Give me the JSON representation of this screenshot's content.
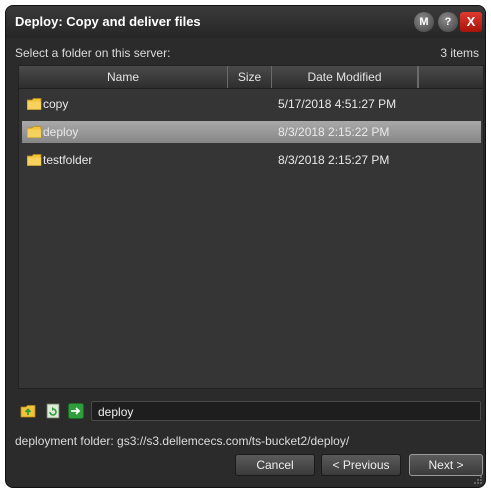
{
  "window": {
    "title": "Deploy: Copy and deliver files",
    "buttons": {
      "m_label": "M",
      "help_label": "?",
      "close_label": "X"
    }
  },
  "browser": {
    "prompt": "Select a folder on this server:",
    "item_count": "3 items",
    "columns": {
      "name": "Name",
      "size": "Size",
      "date": "Date Modified"
    },
    "rows": [
      {
        "name": "copy",
        "date": "5/17/2018 4:51:27 PM",
        "selected": false
      },
      {
        "name": "deploy",
        "date": "8/3/2018 2:15:22 PM",
        "selected": true
      },
      {
        "name": "testfolder",
        "date": "8/3/2018 2:15:27 PM",
        "selected": false
      }
    ]
  },
  "pathbar": {
    "icons": [
      "folder-up-icon",
      "refresh-icon",
      "enter-icon"
    ],
    "value": "deploy"
  },
  "deployment_folder": "deployment folder: gs3://s3.dellemcecs.com/ts-bucket2/deploy/",
  "actions": {
    "cancel": "Cancel",
    "previous": "< Previous",
    "next": "Next >"
  },
  "colors": {
    "folder": "#f2c33b",
    "selection": "#9a9a9a",
    "close": "#d12a1f",
    "accent_green": "#2e9e3c"
  }
}
